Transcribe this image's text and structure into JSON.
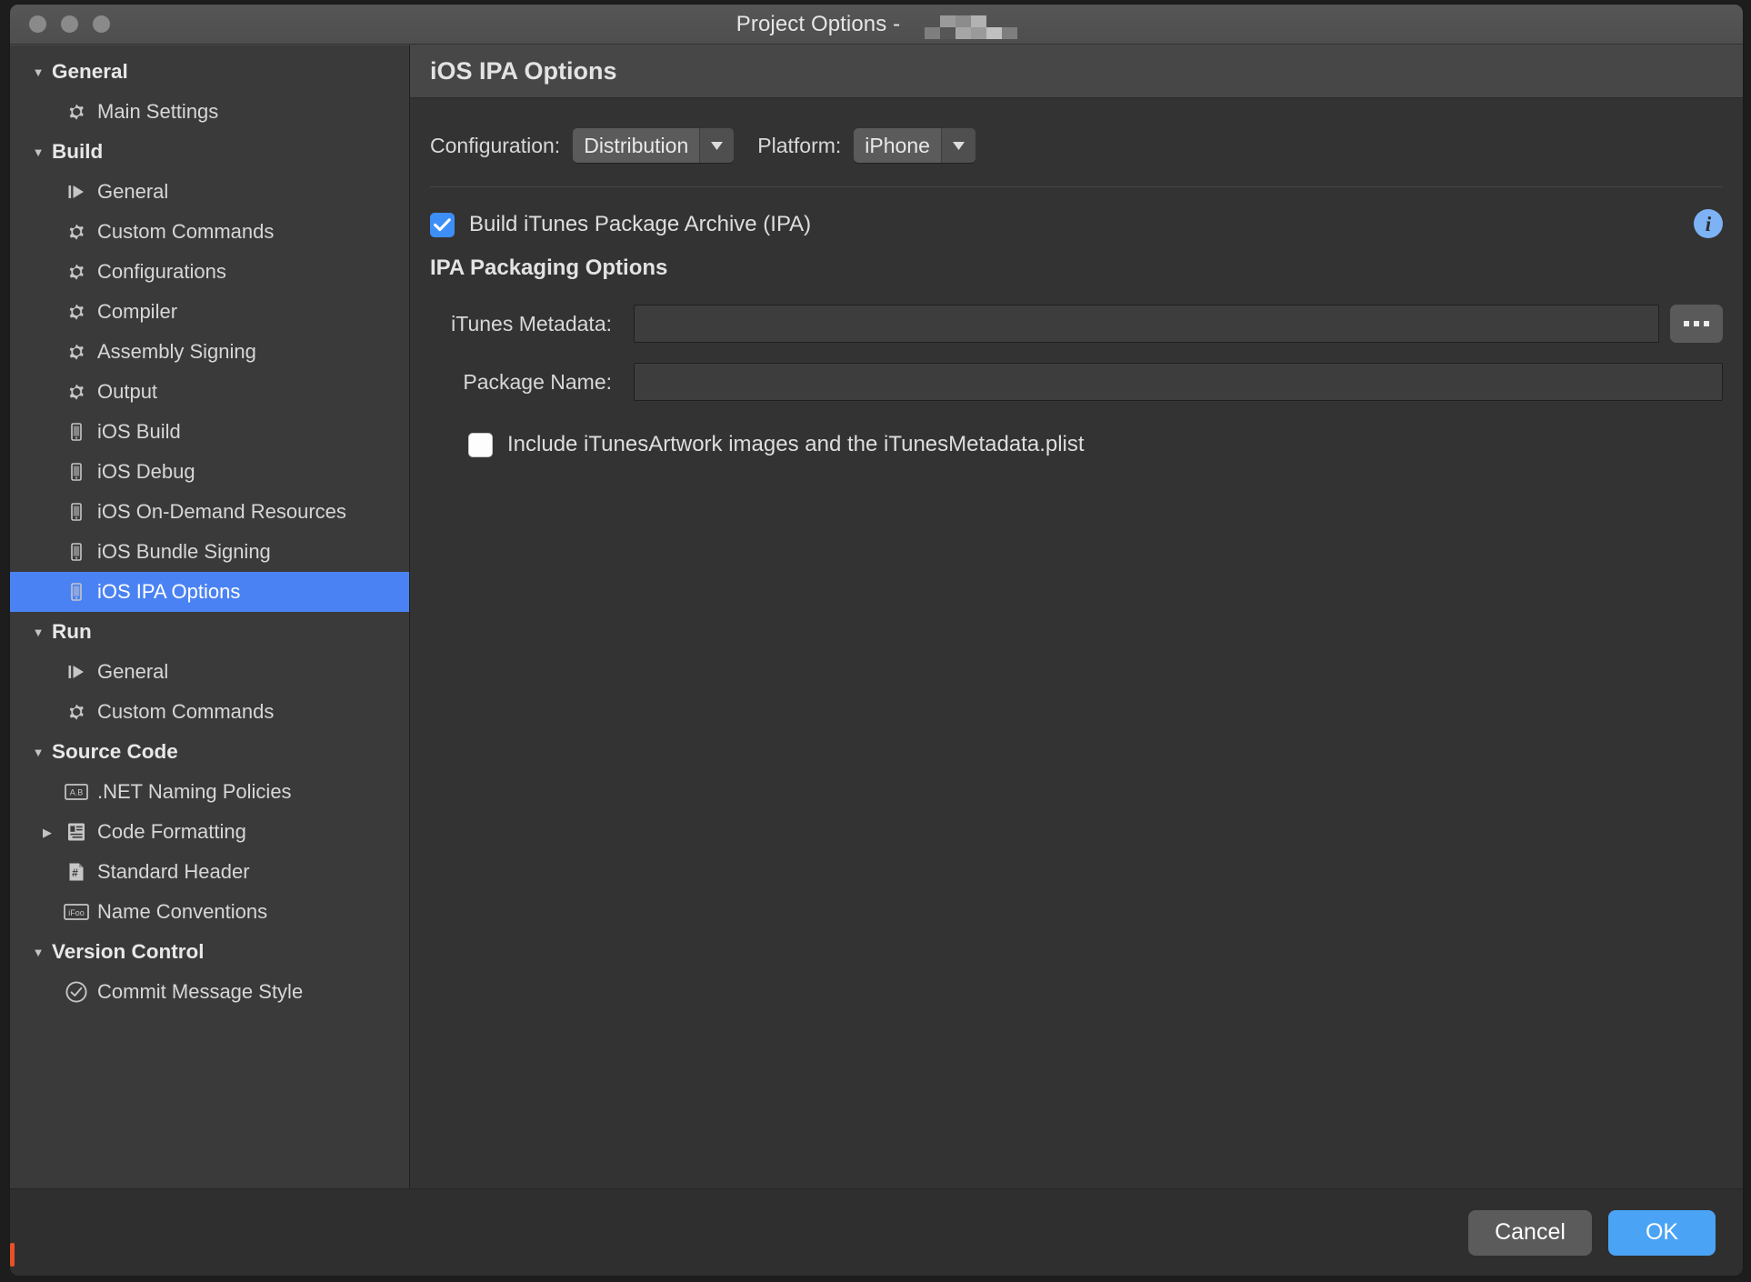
{
  "window": {
    "title_prefix": "Project Options -",
    "redacted_name": "",
    "traffic_lights": [
      "close-button",
      "minimize-button",
      "zoom-button"
    ]
  },
  "sidebar": {
    "items": [
      {
        "label": "General",
        "level": 0,
        "kind": "group",
        "disclosure": "▼",
        "icon": "none",
        "selected": false
      },
      {
        "label": "Main Settings",
        "level": 1,
        "kind": "item",
        "disclosure": "",
        "icon": "gear",
        "selected": false
      },
      {
        "label": "Build",
        "level": 0,
        "kind": "group",
        "disclosure": "▼",
        "icon": "none",
        "selected": false
      },
      {
        "label": "General",
        "level": 1,
        "kind": "item",
        "disclosure": "",
        "icon": "play",
        "selected": false
      },
      {
        "label": "Custom Commands",
        "level": 1,
        "kind": "item",
        "disclosure": "",
        "icon": "gear",
        "selected": false
      },
      {
        "label": "Configurations",
        "level": 1,
        "kind": "item",
        "disclosure": "",
        "icon": "gear",
        "selected": false
      },
      {
        "label": "Compiler",
        "level": 1,
        "kind": "item",
        "disclosure": "",
        "icon": "gear",
        "selected": false
      },
      {
        "label": "Assembly Signing",
        "level": 1,
        "kind": "item",
        "disclosure": "",
        "icon": "gear",
        "selected": false
      },
      {
        "label": "Output",
        "level": 1,
        "kind": "item",
        "disclosure": "",
        "icon": "gear",
        "selected": false
      },
      {
        "label": "iOS Build",
        "level": 1,
        "kind": "item",
        "disclosure": "",
        "icon": "device",
        "selected": false
      },
      {
        "label": "iOS Debug",
        "level": 1,
        "kind": "item",
        "disclosure": "",
        "icon": "device",
        "selected": false
      },
      {
        "label": "iOS On-Demand Resources",
        "level": 1,
        "kind": "item",
        "disclosure": "",
        "icon": "device",
        "selected": false
      },
      {
        "label": "iOS Bundle Signing",
        "level": 1,
        "kind": "item",
        "disclosure": "",
        "icon": "device",
        "selected": false
      },
      {
        "label": "iOS IPA Options",
        "level": 1,
        "kind": "item",
        "disclosure": "",
        "icon": "device",
        "selected": true
      },
      {
        "label": "Run",
        "level": 0,
        "kind": "group",
        "disclosure": "▼",
        "icon": "none",
        "selected": false
      },
      {
        "label": "General",
        "level": 1,
        "kind": "item",
        "disclosure": "",
        "icon": "play",
        "selected": false
      },
      {
        "label": "Custom Commands",
        "level": 1,
        "kind": "item",
        "disclosure": "",
        "icon": "gear",
        "selected": false
      },
      {
        "label": "Source Code",
        "level": 0,
        "kind": "group",
        "disclosure": "▼",
        "icon": "none",
        "selected": false
      },
      {
        "label": ".NET Naming Policies",
        "level": 1,
        "kind": "item",
        "disclosure": "",
        "icon": "ab-box",
        "selected": false
      },
      {
        "label": "Code Formatting",
        "level": 1,
        "kind": "item",
        "disclosure": "▶",
        "icon": "list-box",
        "selected": false
      },
      {
        "label": "Standard Header",
        "level": 1,
        "kind": "item",
        "disclosure": "",
        "icon": "hash-doc",
        "selected": false
      },
      {
        "label": "Name Conventions",
        "level": 1,
        "kind": "item",
        "disclosure": "",
        "icon": "ifoo-box",
        "selected": false
      },
      {
        "label": "Version Control",
        "level": 0,
        "kind": "group",
        "disclosure": "▼",
        "icon": "none",
        "selected": false
      },
      {
        "label": "Commit Message Style",
        "level": 1,
        "kind": "item",
        "disclosure": "",
        "icon": "check-circle",
        "selected": false
      }
    ]
  },
  "main": {
    "panel_title": "iOS IPA Options",
    "configuration": {
      "label": "Configuration:",
      "value": "Distribution"
    },
    "platform": {
      "label": "Platform:",
      "value": "iPhone"
    },
    "build_ipa": {
      "label": "Build iTunes Package Archive (IPA)",
      "checked": true
    },
    "info_icon_label": "i",
    "packaging_section_title": "IPA Packaging Options",
    "itunes_metadata": {
      "label": "iTunes Metadata:",
      "value": "",
      "placeholder": "",
      "browse_label": "..."
    },
    "package_name": {
      "label": "Package Name:",
      "value": "",
      "placeholder": ""
    },
    "include_artwork": {
      "label": "Include iTunesArtwork images and the iTunesMetadata.plist",
      "checked": false
    }
  },
  "footer": {
    "cancel_label": "Cancel",
    "ok_label": "OK"
  },
  "colors": {
    "accent_blue": "#4a82f3",
    "ok_blue": "#4aa3f5",
    "checkbox_blue": "#3e8ef7",
    "info_blue": "#7db3f5",
    "titlebar": "#565656",
    "sidebar_bg": "#3a3a3a",
    "panel_bg": "#333333",
    "edge_marker": "#e8502a"
  }
}
